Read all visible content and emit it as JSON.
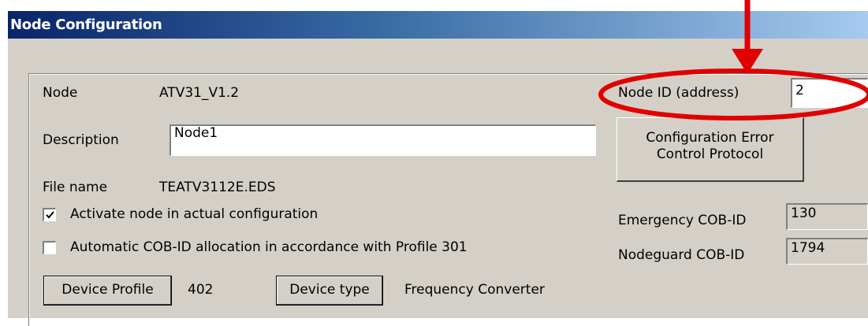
{
  "window": {
    "title": "Node Configuration"
  },
  "node": {
    "label": "Node",
    "value": "ATV31_V1.2"
  },
  "description": {
    "label": "Description",
    "value": "Node1"
  },
  "file": {
    "label": "File name",
    "value": "TEATV3112E.EDS"
  },
  "options": {
    "activate_label": "Activate node in actual configuration",
    "activate_checked": true,
    "auto_cob_label": "Automatic COB-ID allocation in accordance with Profile 301",
    "auto_cob_checked": false
  },
  "device": {
    "profile_button": "Device Profile",
    "profile_value": "402",
    "type_button": "Device type",
    "type_value": "Frequency Converter"
  },
  "node_id": {
    "label": "Node ID (address)",
    "value": "2"
  },
  "config_error_button": {
    "line1": "Configuration Error",
    "line2": "Control Protocol"
  },
  "emergency": {
    "label": "Emergency COB-ID",
    "value": "130"
  },
  "nodeguard": {
    "label": "Nodeguard COB-ID",
    "value": "1794"
  },
  "annotation": {
    "color": "#e00000"
  }
}
